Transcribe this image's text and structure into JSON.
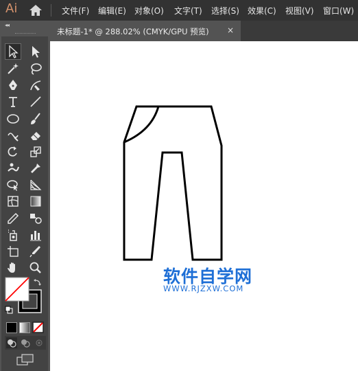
{
  "app": {
    "logo": "Ai"
  },
  "menu": [
    {
      "label": "文件(F)",
      "name": "menu-file"
    },
    {
      "label": "编辑(E)",
      "name": "menu-edit"
    },
    {
      "label": "对象(O)",
      "name": "menu-object"
    },
    {
      "label": "文字(T)",
      "name": "menu-type"
    },
    {
      "label": "选择(S)",
      "name": "menu-select"
    },
    {
      "label": "效果(C)",
      "name": "menu-effect"
    },
    {
      "label": "视图(V)",
      "name": "menu-view"
    },
    {
      "label": "窗口(W)",
      "name": "menu-window"
    }
  ],
  "panel": {
    "collapse_label": "◂◂"
  },
  "document_tab": {
    "title": "未标题-1* @ 288.02% (CMYK/GPU 预览)",
    "close": "×"
  },
  "zoom": "288.02%",
  "color_mode": "CMYK/GPU 预览",
  "watermark": {
    "title": "软件自学网",
    "url": "WWW.RJZXW.COM",
    "color": "#1e6fd6"
  },
  "colors": {
    "brand": "#d4926c",
    "menubar": "#323232",
    "toolbar": "#434343",
    "accent_stroke": "#ff0000"
  },
  "tools": [
    {
      "name": "selection-tool-icon",
      "sel": true
    },
    {
      "name": "direct-selection-tool-icon"
    },
    {
      "name": "magic-wand-tool-icon"
    },
    {
      "name": "lasso-tool-icon"
    },
    {
      "name": "pen-tool-icon"
    },
    {
      "name": "curvature-tool-icon"
    },
    {
      "name": "type-tool-icon"
    },
    {
      "name": "line-segment-tool-icon"
    },
    {
      "name": "ellipse-tool-icon"
    },
    {
      "name": "paintbrush-tool-icon"
    },
    {
      "name": "shaper-tool-icon"
    },
    {
      "name": "eraser-tool-icon"
    },
    {
      "name": "rotate-tool-icon"
    },
    {
      "name": "scale-tool-icon"
    },
    {
      "name": "puppet-warp-tool-icon"
    },
    {
      "name": "free-transform-tool-icon"
    },
    {
      "name": "shape-builder-tool-icon"
    },
    {
      "name": "perspective-grid-tool-icon"
    },
    {
      "name": "mesh-tool-icon"
    },
    {
      "name": "gradient-tool-icon"
    },
    {
      "name": "eyedropper-tool-icon"
    },
    {
      "name": "blend-tool-icon"
    },
    {
      "name": "symbol-sprayer-tool-icon"
    },
    {
      "name": "column-graph-tool-icon"
    },
    {
      "name": "artboard-tool-icon"
    },
    {
      "name": "slice-tool-icon"
    },
    {
      "name": "hand-tool-icon"
    },
    {
      "name": "zoom-tool-icon"
    }
  ]
}
